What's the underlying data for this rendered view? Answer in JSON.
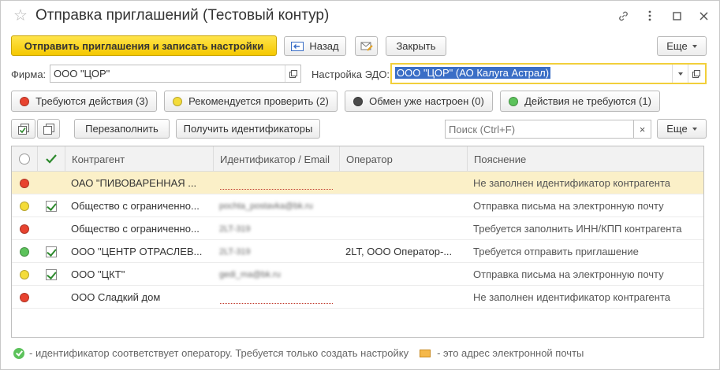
{
  "window": {
    "title": "Отправка приглашений (Тестовый контур)"
  },
  "toolbar": {
    "send_label": "Отправить приглашения и записать настройки",
    "back_label": "Назад",
    "close_label": "Закрыть",
    "more_label": "Еще"
  },
  "form": {
    "firm_label": "Фирма:",
    "firm_value": "ООО \"ЦОР\"",
    "edo_label": "Настройка ЭДО:",
    "edo_value": "ООО \"ЦОР\" (АО Калуга Астрал)"
  },
  "filters": [
    {
      "label": "Требуются действия (3)",
      "color": "#e8432f"
    },
    {
      "label": "Рекомендуется проверить (2)",
      "color": "#f4dc3a"
    },
    {
      "label": "Обмен уже настроен (0)",
      "color": "#4a4a4a"
    },
    {
      "label": "Действия не требуются (1)",
      "color": "#5cc25b"
    }
  ],
  "table_toolbar": {
    "refill_label": "Перезаполнить",
    "get_ids_label": "Получить идентификаторы",
    "search_placeholder": "Поиск (Ctrl+F)",
    "clear_glyph": "×",
    "more_label": "Еще"
  },
  "table": {
    "columns": [
      "Контрагент",
      "Идентификатор / Email",
      "Оператор",
      "Пояснение"
    ],
    "rows": [
      {
        "status": "red",
        "checked": false,
        "name": "ОАО \"ПИВОВАРЕННАЯ ...",
        "id": "",
        "operator": "",
        "note": "Не заполнен идентификатор контрагента"
      },
      {
        "status": "yellow",
        "checked": true,
        "name": "Общество с ограниченно...",
        "id": "pochta_postavka@bk.ru",
        "operator": "",
        "note": "Отправка письма на электронную почту"
      },
      {
        "status": "red",
        "checked": false,
        "name": "Общество с ограниченно...",
        "id": "2LT-319",
        "operator": "",
        "note": "Требуется заполнить ИНН/КПП контрагента"
      },
      {
        "status": "green",
        "checked": true,
        "name": "ООО \"ЦЕНТР ОТРАСЛЕВ...",
        "id": "2LT-319",
        "operator": "2LT, ООО Оператор-...",
        "note": "Требуется отправить приглашение"
      },
      {
        "status": "yellow",
        "checked": true,
        "name": "ООО \"ЦКТ\"",
        "id": "gedi_ma@bk.ru",
        "operator": "",
        "note": "Отправка письма на электронную почту"
      },
      {
        "status": "red",
        "checked": false,
        "name": "ООО Сладкий дом",
        "id": "",
        "operator": "",
        "note": "Не заполнен идентификатор контрагента"
      }
    ]
  },
  "footer": {
    "legend_green": "- идентификатор соответствует оператору. Требуется только создать настройку",
    "legend_envelope": "- это адрес электронной почты"
  }
}
